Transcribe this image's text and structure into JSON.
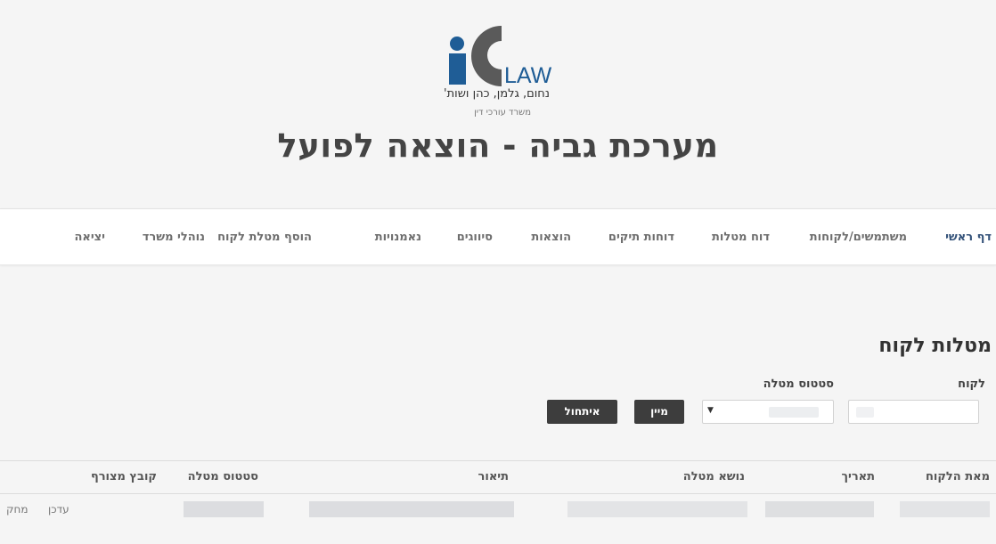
{
  "header": {
    "logo_text": "LAW",
    "firm_name": "נחום, גלמן, כהן ושות'",
    "firm_subtitle": "משרד עורכי דין",
    "site_title": "מערכת גביה - הוצאה לפועל"
  },
  "nav": {
    "items": [
      {
        "label": "דף ראשי"
      },
      {
        "label": "משתמשים/לקוחות"
      },
      {
        "label": "דוח מטלות"
      },
      {
        "label": "דוחות תיקים"
      },
      {
        "label": "הוצאות"
      },
      {
        "label": "סיווגים"
      },
      {
        "label": "נאמנויות"
      },
      {
        "label": "הוסף מטלת לקוח"
      },
      {
        "label": "נוהלי משרד"
      },
      {
        "label": "יציאה"
      }
    ]
  },
  "page": {
    "heading": "מטלות לקוח"
  },
  "filters": {
    "client_label": "לקוח",
    "client_value": "",
    "status_label": "סטטוס מטלה",
    "status_value": "",
    "sort_button": "מיין",
    "reset_button": "איתחול"
  },
  "table": {
    "columns": [
      "מאת הלקוח",
      "תאריך",
      "נושא מטלה",
      "תיאור",
      "סטטוס מטלה",
      "קובץ מצורף"
    ],
    "row_actions": {
      "edit": "עדכן",
      "delete": "מחק"
    }
  },
  "colors": {
    "logo_blue": "#1f5d96",
    "logo_gray": "#5a5a5a",
    "nav_active": "#35537a",
    "button_dark": "#3d3d3d"
  }
}
